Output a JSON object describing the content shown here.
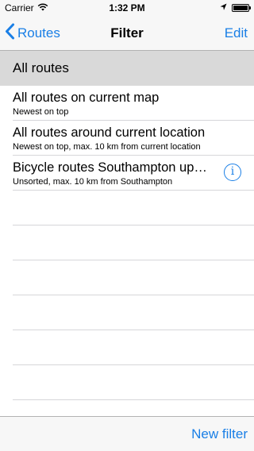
{
  "status_bar": {
    "carrier": "Carrier",
    "time": "1:32 PM",
    "battery_level": 1.0
  },
  "nav": {
    "back_label": "Routes",
    "title": "Filter",
    "edit_label": "Edit"
  },
  "section": {
    "header": "All routes"
  },
  "rows": [
    {
      "title": "All routes on current map",
      "subtitle": "Newest on top"
    },
    {
      "title": "All routes around current location",
      "subtitle": "Newest on top, max. 10 km from current location"
    },
    {
      "title": "Bicycle routes Southampton up…",
      "subtitle": "Unsorted, max. 10 km from Southampton"
    }
  ],
  "toolbar": {
    "new_filter_label": "New filter"
  },
  "colors": {
    "accent": "#1a7fe6",
    "bar_background": "#f7f7f7",
    "section_background": "#d9d9d9"
  }
}
